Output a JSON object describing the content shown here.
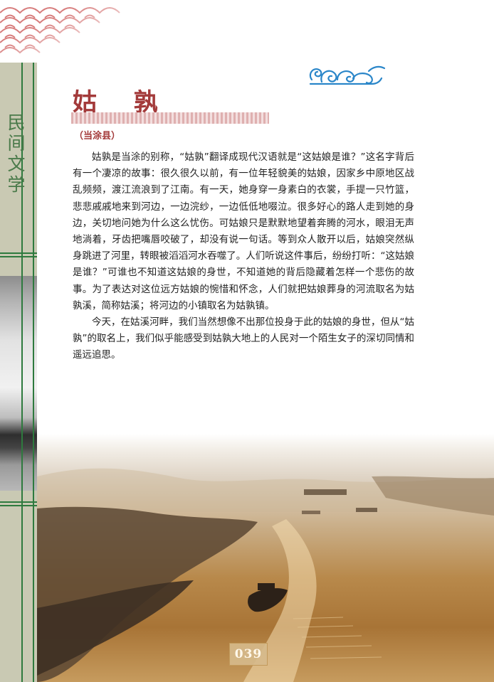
{
  "sidebar": {
    "section_title": "民间文学"
  },
  "article": {
    "title": "姑 孰",
    "subtitle": "（当涂县）",
    "paragraphs": [
      "姑孰是当涂的别称，“姑孰”翻译成现代汉语就是“这姑娘是谁？”这名字背后有一个凄凉的故事：很久很久以前，有一位年轻貌美的姑娘，因家乡中原地区战乱频频，渡江流浪到了江南。有一天，她身穿一身素白的衣裳，手提一只竹篮，悲悲戚戚地来到河边，一边浣纱，一边低低地啜泣。很多好心的路人走到她的身边，关切地问她为什么这么忧伤。可姑娘只是默默地望着奔腾的河水，眼泪无声地淌着，牙齿把嘴唇咬破了，却没有说一句话。等到众人散开以后，姑娘突然纵身跳进了河里，转眼被滔滔河水吞噬了。人们听说这件事后，纷纷打听：“这姑娘是谁？”可谁也不知道这姑娘的身世，不知道她的背后隐藏着怎样一个悲伤的故事。为了表达对这位远方姑娘的惋惜和怀念，人们就把姑娘葬身的河流取名为姑孰溪，简称姑溪；将河边的小镇取名为姑孰镇。",
      "今天，在姑溪河畔，我们当然想像不出那位投身于此的姑娘的身世，但从“姑孰”的取名上，我们似乎能感受到姑孰大地上的人民对一个陌生女子的深切同情和遥远追思。"
    ]
  },
  "footer": {
    "page_number": "039"
  },
  "colors": {
    "title_red": "#a33a3a",
    "frame_green": "#2e7a3e",
    "sidebar_bg": "#c9c9b3",
    "cloud_blue": "#2a86c9"
  }
}
